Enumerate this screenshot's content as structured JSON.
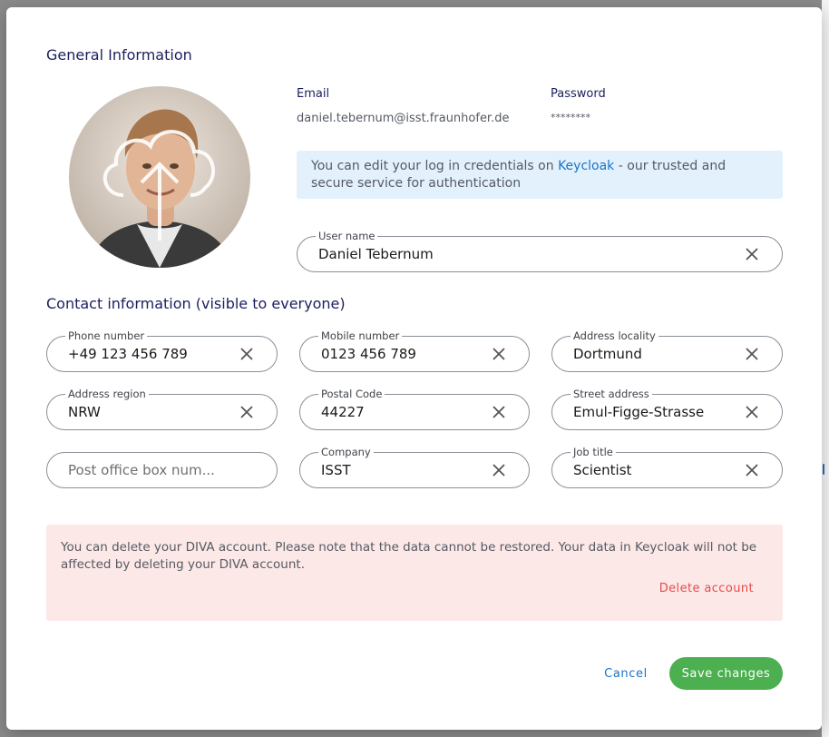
{
  "general": {
    "title": "General Information",
    "email_label": "Email",
    "email_value": "daniel.tebernum@isst.fraunhofer.de",
    "password_label": "Password",
    "password_value": "********",
    "info_text_before": "You can edit your log in credentials on ",
    "info_link": "Keycloak",
    "info_text_after": " - our trusted and secure service for authentication",
    "username_label": "User name",
    "username_value": "Daniel Tebernum"
  },
  "contact": {
    "title": "Contact information (visible to everyone)",
    "phone_label": "Phone number",
    "phone_value": "+49 123 456 789",
    "mobile_label": "Mobile number",
    "mobile_value": "0123 456 789",
    "locality_label": "Address locality",
    "locality_value": "Dortmund",
    "region_label": "Address region",
    "region_value": "NRW",
    "postal_label": "Postal Code",
    "postal_value": "44227",
    "street_label": "Street address",
    "street_value": "Emul-Figge-Strasse",
    "pobox_placeholder": "Post office box num...",
    "company_label": "Company",
    "company_value": "ISST",
    "job_label": "Job title",
    "job_value": "Scientist"
  },
  "danger": {
    "text": "You can delete your DIVA account. Please note that the data cannot be restored. Your data in Keycloak will not be affected by deleting your DIVA account.",
    "delete_label": "Delete account"
  },
  "actions": {
    "cancel_label": "Cancel",
    "save_label": "Save changes"
  },
  "colors": {
    "title": "#1b1f5e",
    "link": "#1a73c8",
    "save": "#4caf50",
    "danger": "#e44b4b",
    "info_bg": "#e3f1fd",
    "danger_bg": "#fde8e8"
  },
  "icons": {
    "upload": "cloud-upload-icon",
    "clear": "close-icon"
  }
}
